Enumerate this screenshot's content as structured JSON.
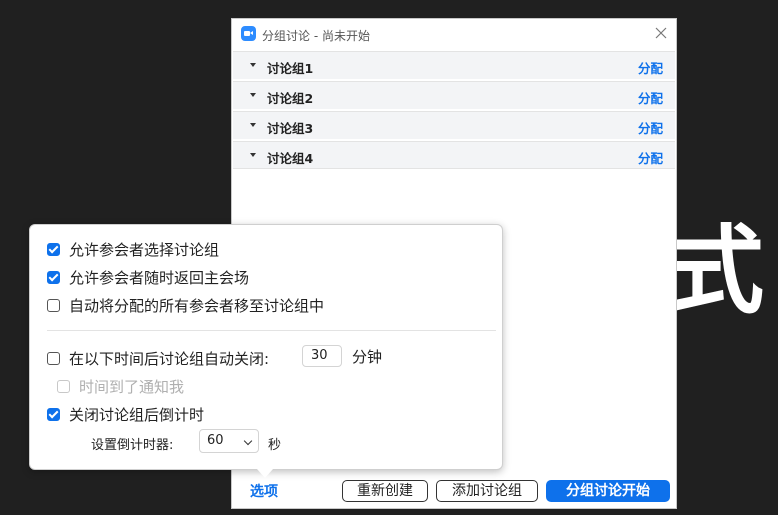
{
  "background": {
    "glyph": "式"
  },
  "window": {
    "title": "分组讨论 - 尚未开始",
    "groups": [
      {
        "name": "讨论组1",
        "action": "分配"
      },
      {
        "name": "讨论组2",
        "action": "分配"
      },
      {
        "name": "讨论组3",
        "action": "分配"
      },
      {
        "name": "讨论组4",
        "action": "分配"
      }
    ]
  },
  "options_popup": {
    "allow_choose": {
      "label": "允许参会者选择讨论组",
      "checked": true
    },
    "allow_return": {
      "label": "允许参会者随时返回主会场",
      "checked": true
    },
    "auto_move": {
      "label": "自动将分配的所有参会者移至讨论组中",
      "checked": false
    },
    "auto_close": {
      "label": "在以下时间后讨论组自动关闭:",
      "checked": false,
      "minutes": "30",
      "unit": "分钟"
    },
    "notify": {
      "label": "时间到了通知我",
      "checked": false,
      "disabled": true
    },
    "countdown": {
      "label": "关闭讨论组后倒计时",
      "checked": true
    },
    "timer": {
      "label": "设置倒计时器:",
      "value": "60",
      "unit": "秒"
    }
  },
  "footer": {
    "options_link": "选项",
    "recreate_button": "重新创建",
    "add_group_button": "添加讨论组",
    "start_button": "分组讨论开始"
  },
  "colors": {
    "accent": "#0e71eb",
    "background": "#202020"
  }
}
